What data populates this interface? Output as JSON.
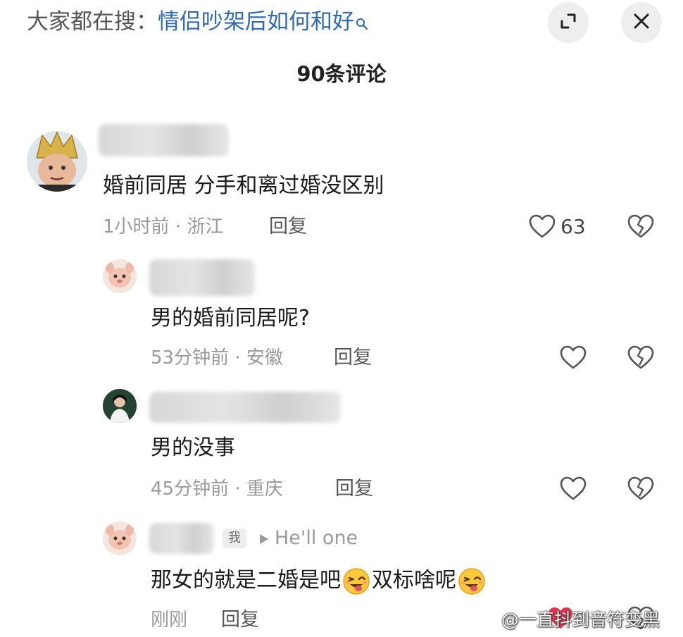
{
  "search": {
    "prefix": "大家都在搜：",
    "query": "情侣吵架后如何和好"
  },
  "header": {
    "comment_count": "90条评论"
  },
  "comments": [
    {
      "text": "婚前同居 分手和离过婚没区别",
      "time_location": "1小时前 · 浙江",
      "reply_label": "回复",
      "likes": "63",
      "replies": [
        {
          "text": "男的婚前同居呢?",
          "time_location": "53分钟前 · 安徽",
          "reply_label": "回复"
        },
        {
          "text": "男的没事",
          "time_location": "45分钟前 · 重庆",
          "reply_label": "回复"
        },
        {
          "author_tag": "我",
          "reply_to": "He'll one",
          "text_part1": "那女的就是二婚是吧",
          "text_part2": "双标啥呢",
          "time_location": "刚刚",
          "reply_label": "回复"
        }
      ]
    }
  ],
  "watermark": "@一直抖到音符变黑",
  "icons": {
    "search": "search-icon",
    "expand": "expand-icon",
    "close": "close-icon",
    "like": "heart-icon",
    "dislike": "broken-heart-icon",
    "emoji": "winking-tongue-emoji"
  },
  "colors": {
    "search_query": "#2f6ab3",
    "meta_text": "#9a9a9a",
    "liked_heart": "#e8344e"
  }
}
